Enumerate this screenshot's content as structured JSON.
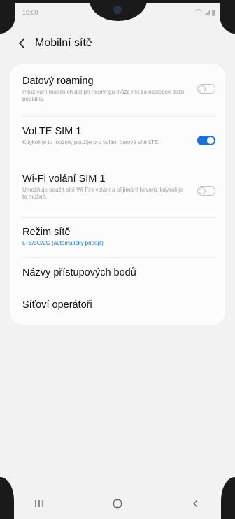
{
  "status_bar": {
    "time": "10:00",
    "icons": [
      "wifi-icon",
      "signal-icon",
      "battery-icon"
    ]
  },
  "header": {
    "back_icon": "chevron-left-icon",
    "title": "Mobilní sítě"
  },
  "settings": [
    {
      "title": "Datový roaming",
      "subtitle": "Používání mobilních dat při roamingu může mít za následek další poplatky.",
      "toggle": "off"
    },
    {
      "title": "VoLTE SIM 1",
      "subtitle": "Kdykoli je to možné, použije pro volání datové sítě LTE.",
      "toggle": "on"
    },
    {
      "title": "Wi-Fi volání SIM 1",
      "subtitle": "Umožňuje použít sítě Wi-Fi k volání a přijímání hovorů, kdykoli je to možné.",
      "toggle": "off"
    },
    {
      "title": "Režim sítě",
      "subtitle": "LTE/3G/2G (automaticky připojit)"
    },
    {
      "title": "Názvy přístupových bodů"
    },
    {
      "title": "Síťoví operátoři"
    }
  ],
  "nav_bar": {
    "icons": [
      "recent-apps-icon",
      "home-icon",
      "back-icon"
    ]
  },
  "colors": {
    "accent": "#1e6fd9",
    "background": "#f2f2f2",
    "card": "#fcfcfc"
  }
}
